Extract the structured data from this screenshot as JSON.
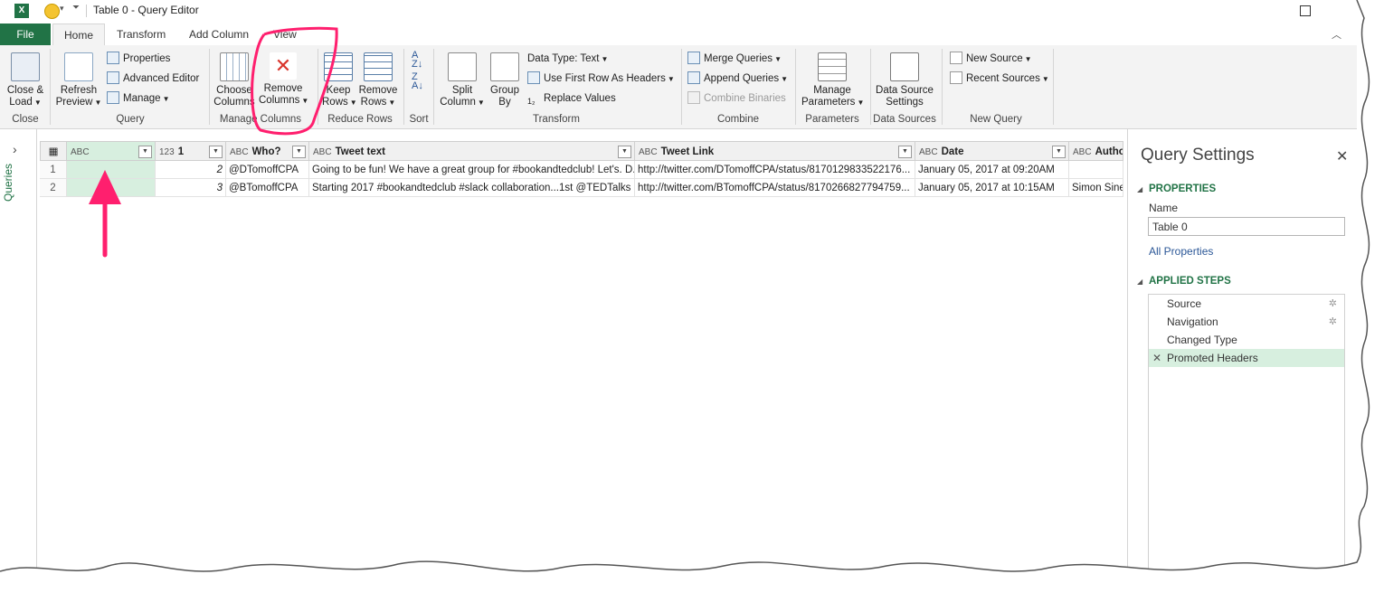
{
  "window": {
    "title": "Table 0 - Query Editor"
  },
  "tabs": [
    "File",
    "Home",
    "Transform",
    "Add Column",
    "View"
  ],
  "ribbon": {
    "close": {
      "label1": "Close &",
      "label2": "Load",
      "group": "Close"
    },
    "refresh": {
      "label1": "Refresh",
      "label2": "Preview"
    },
    "properties": "Properties",
    "advanced_editor": "Advanced Editor",
    "manage": "Manage",
    "query_group": "Query",
    "choose_columns": {
      "label1": "Choose",
      "label2": "Columns"
    },
    "remove_columns": {
      "label1": "Remove",
      "label2": "Columns"
    },
    "manage_columns_group": "Manage Columns",
    "keep_rows": {
      "label1": "Keep",
      "label2": "Rows"
    },
    "remove_rows": {
      "label1": "Remove",
      "label2": "Rows"
    },
    "reduce_rows_group": "Reduce Rows",
    "sort_group": "Sort",
    "split_column": {
      "label1": "Split",
      "label2": "Column"
    },
    "group_by": {
      "label1": "Group",
      "label2": "By"
    },
    "data_type": "Data Type: Text",
    "use_first_row": "Use First Row As Headers",
    "replace_values": "Replace Values",
    "transform_group": "Transform",
    "merge_queries": "Merge Queries",
    "append_queries": "Append Queries",
    "combine_binaries": "Combine Binaries",
    "combine_group": "Combine",
    "manage_parameters": {
      "label1": "Manage",
      "label2": "Parameters"
    },
    "parameters_group": "Parameters",
    "data_source_settings": {
      "label1": "Data Source",
      "label2": "Settings"
    },
    "data_sources_group": "Data Sources",
    "new_source": "New Source",
    "recent_sources": "Recent Sources",
    "new_query_group": "New Query"
  },
  "queries_pane": {
    "label": "Queries"
  },
  "grid": {
    "columns": [
      {
        "type": "ABC",
        "name": ""
      },
      {
        "type": "123",
        "name": "1"
      },
      {
        "type": "ABC",
        "name": "Who?"
      },
      {
        "type": "ABC",
        "name": "Tweet text"
      },
      {
        "type": "ABC",
        "name": "Tweet Link"
      },
      {
        "type": "ABC",
        "name": "Date"
      },
      {
        "type": "ABC",
        "name": "Author"
      }
    ],
    "rows": [
      {
        "n": "1",
        "c0": "",
        "c1": "2",
        "c2": "@DTomoffCPA",
        "c3": "Going to be fun! We have a great group for #bookandtedclub! Let's. D...",
        "c4": "http://twitter.com/DTomoffCPA/status/8170129833522176...",
        "c5": "January 05, 2017 at 09:20AM",
        "c6": ""
      },
      {
        "n": "2",
        "c0": "",
        "c1": "3",
        "c2": "@BTomoffCPA",
        "c3": "Starting 2017 #bookandtedclub #slack collaboration...1st @TEDTalks ...",
        "c4": "http://twitter.com/BTomoffCPA/status/8170266827794759...",
        "c5": "January 05, 2017 at 10:15AM",
        "c6": "Simon Sinek"
      }
    ]
  },
  "query_settings": {
    "title": "Query Settings",
    "properties_header": "PROPERTIES",
    "name_label": "Name",
    "name_value": "Table 0",
    "all_properties": "All Properties",
    "applied_steps_header": "APPLIED STEPS",
    "steps": [
      "Source",
      "Navigation",
      "Changed Type",
      "Promoted Headers"
    ]
  },
  "colors": {
    "accent": "#217346",
    "annotation": "#ff1f6e",
    "selected": "#d7efdf"
  }
}
